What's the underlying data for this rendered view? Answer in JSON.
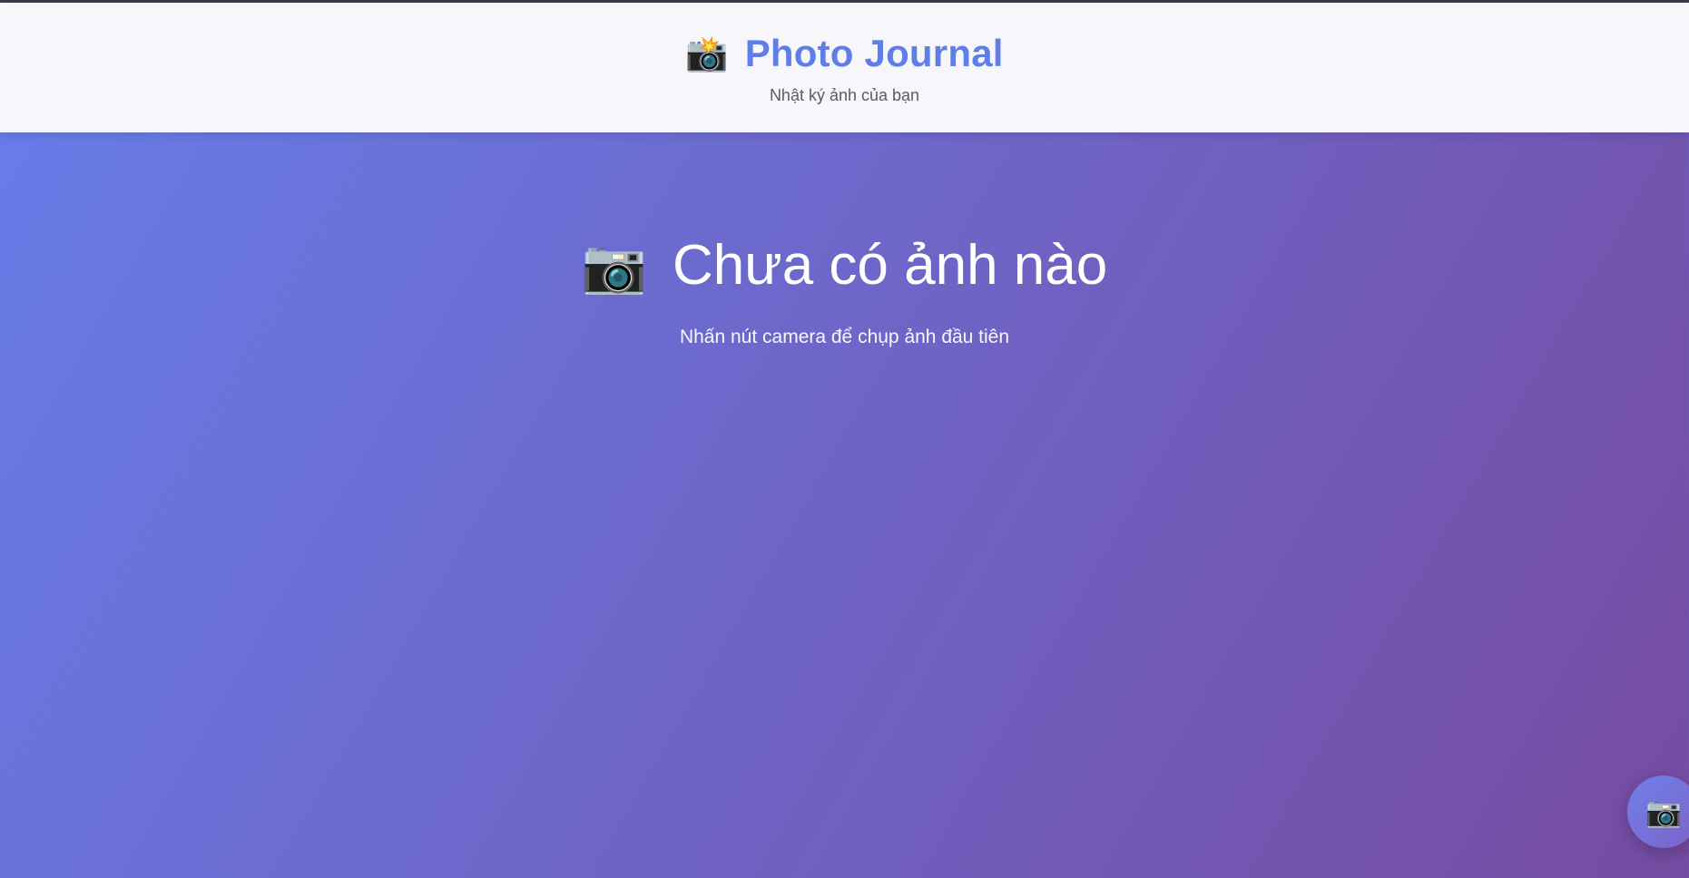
{
  "header": {
    "icon": "camera-with-flash-icon",
    "icon_glyph": "📸",
    "title": "Photo Journal",
    "subtitle": "Nhật ký ảnh của bạn"
  },
  "empty_state": {
    "icon": "camera-icon",
    "icon_glyph": "📷",
    "title": "Chưa có ảnh nào",
    "subtitle": "Nhấn nút camera để chụp ảnh đầu tiên"
  },
  "fab": {
    "icon": "camera-icon",
    "icon_glyph": "📷"
  },
  "colors": {
    "brand_title": "#5f7fe6",
    "background_start": "#667eea",
    "background_end": "#764ba2"
  }
}
